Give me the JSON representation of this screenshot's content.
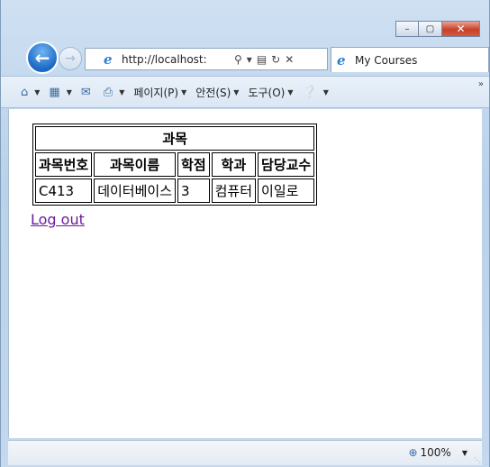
{
  "browser": {
    "address": "http://localhost:",
    "tab_title": "My Courses",
    "window_buttons": {
      "minimize": "–",
      "maximize": "▢",
      "close": "✕"
    },
    "icons": {
      "back": "arrow-left-icon",
      "forward": "arrow-right-icon",
      "ie": "ie-logo-icon"
    }
  },
  "command_bar": {
    "page": "페이지(P)",
    "safety": "안전(S)",
    "tools": "도구(O)",
    "more": "»"
  },
  "courses_table": {
    "caption": "과목",
    "headers": [
      "과목번호",
      "과목이름",
      "학점",
      "학과",
      "담당교수"
    ],
    "rows": [
      [
        "C413",
        "데이터베이스",
        "3",
        "컴퓨터",
        "이일로"
      ]
    ]
  },
  "logout_label": "Log out",
  "status": {
    "zoom": "100%"
  },
  "colors": {
    "link_visited": "#6a1b9a",
    "frame": "#b9d1ea",
    "accent": "#1c68c4"
  }
}
